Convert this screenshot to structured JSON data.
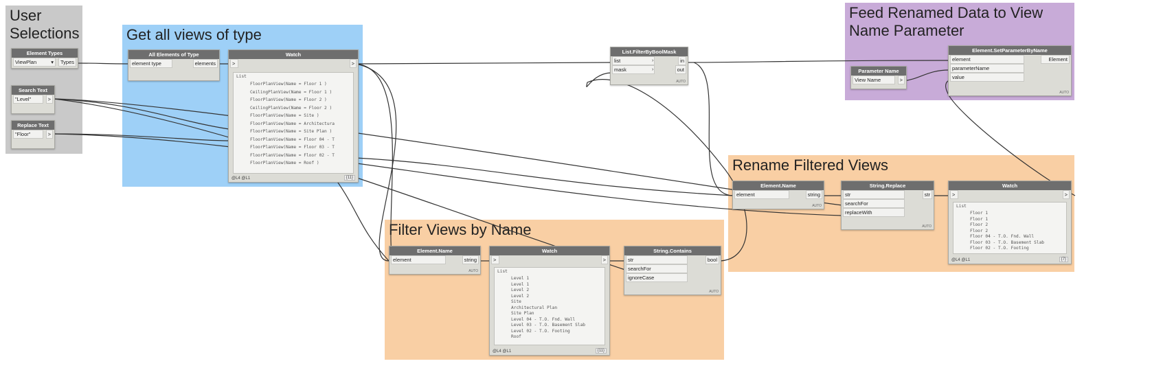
{
  "groups": {
    "user_selections": "User Selections",
    "get_views": "Get all views of type",
    "feed_renamed": "Feed Renamed Data to View Name Parameter",
    "rename_filtered": "Rename Filtered Views",
    "filter_views": "Filter Views by Name"
  },
  "colors": {
    "gray_group": "#c9c9c9",
    "blue_group": "#9ed0f7",
    "purple_group": "#c8abd8",
    "orange_group": "#f9cfa4",
    "node_header": "#6e6e6e",
    "node_body": "#dcdcd6"
  },
  "nodes": {
    "element_types": {
      "title": "Element Types",
      "value": "ViewPlan",
      "output": "Types"
    },
    "search_text": {
      "title": "Search Text",
      "value": "\"Level\"",
      "output": ">"
    },
    "replace_text": {
      "title": "Replace Text",
      "value": "\"Floor\"",
      "output": ">"
    },
    "all_elements_of_type": {
      "title": "All Elements of Type",
      "input": "element type",
      "output": "elements"
    },
    "watch_main": {
      "title": "Watch",
      "input": ">",
      "output": ">",
      "list_label": "List",
      "items": [
        "FloorPlanView(Name = Floor 1 )",
        "CeilingPlanView(Name = Floor 1 )",
        "FloorPlanView(Name = Floor 2 )",
        "CeilingPlanView(Name = Floor 2 )",
        "FloorPlanView(Name = Site )",
        "FloorPlanView(Name = Architectura",
        "FloorPlanView(Name = Site Plan )",
        "FloorPlanView(Name = Floor 04 - T",
        "FloorPlanView(Name = Floor 03 - T",
        "FloorPlanView(Name = Floor 02 - T",
        "FloorPlanView(Name = Roof )"
      ],
      "footer": "@L4 @L1",
      "count": "{11}"
    },
    "filter_by_bool_mask": {
      "title": "List.FilterByBoolMask",
      "in1": "list",
      "in2": "mask",
      "out1": "in",
      "out2": "out",
      "lacing": "AUTO"
    },
    "set_parameter": {
      "title": "Element.SetParameterByName",
      "in1": "element",
      "in2": "parameterName",
      "in3": "value",
      "out": "Element",
      "lacing": "AUTO"
    },
    "parameter_name": {
      "title": "Parameter Name",
      "value": "View Name",
      "output": ">"
    },
    "element_name_rename": {
      "title": "Element.Name",
      "input": "element",
      "output": "string",
      "lacing": "AUTO"
    },
    "string_replace": {
      "title": "String.Replace",
      "in1": "str",
      "in2": "searchFor",
      "in3": "replaceWith",
      "out": "str",
      "lacing": "AUTO"
    },
    "watch_rename": {
      "title": "Watch",
      "input": ">",
      "output": ">",
      "list_label": "List",
      "items": [
        "Floor 1",
        "Floor 1",
        "Floor 2",
        "Floor 2",
        "Floor 04 - T.O. Fnd. Wall",
        "Floor 03 - T.O. Basement Slab",
        "Floor 02 - T.O. Footing"
      ],
      "footer": "@L4 @L1",
      "count": "{7}"
    },
    "element_name_filter": {
      "title": "Element.Name",
      "input": "element",
      "output": "string",
      "lacing": "AUTO"
    },
    "watch_filter": {
      "title": "Watch",
      "input": ">",
      "output": ">",
      "list_label": "List",
      "items": [
        "Level 1",
        "Level 1",
        "Level 2",
        "Level 2",
        "Site",
        "Architectural Plan",
        "Site Plan",
        "Level 04 - T.O. Fnd. Wall",
        "Level 03 - T.O. Basement Slab",
        "Level 02 - T.O. Footing",
        "Roof"
      ],
      "footer": "@L4 @L1",
      "count": "{11}"
    },
    "string_contains": {
      "title": "String.Contains",
      "in1": "str",
      "in2": "searchFor",
      "in3": "ignoreCase",
      "out": "bool",
      "lacing": "AUTO"
    }
  }
}
